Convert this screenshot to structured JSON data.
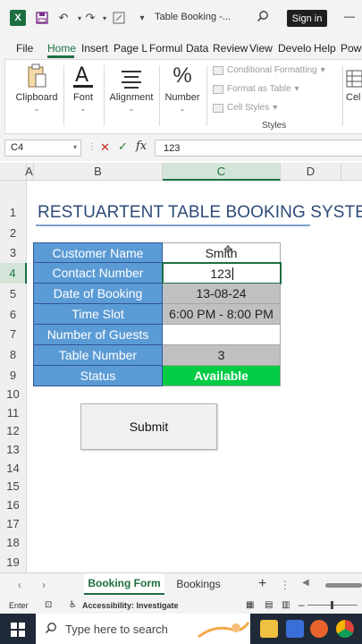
{
  "titlebar": {
    "doc_title": "Table Booking  -...",
    "signin_label": "Sign in",
    "app_logo": "X"
  },
  "menu": {
    "tabs": [
      "File",
      "Home",
      "Insert",
      "Page L",
      "Formul",
      "Data",
      "Review",
      "View",
      "Develo",
      "Help",
      "Powe"
    ],
    "active_tab": "Home"
  },
  "ribbon": {
    "clipboard": "Clipboard",
    "font": "Font",
    "alignment": "Alignment",
    "number": "Number",
    "conditional_formatting": "Conditional Formatting",
    "format_as_table": "Format as Table",
    "cell_styles": "Cell Styles",
    "styles_group": "Styles",
    "cells": "Cel"
  },
  "formula_bar": {
    "name_box": "C4",
    "value": "123"
  },
  "grid": {
    "columns": [
      "A",
      "B",
      "C",
      "D"
    ],
    "selected_column": "C",
    "rows": [
      "1",
      "2",
      "3",
      "4",
      "5",
      "6",
      "7",
      "8",
      "9",
      "10",
      "11",
      "12",
      "13",
      "14",
      "15",
      "16",
      "17",
      "18",
      "19"
    ],
    "selected_row": "4"
  },
  "sheet": {
    "title": "RESTUARTENT TABLE BOOKING SYSTEM",
    "form": [
      {
        "label": "Customer Name",
        "value": "Smith"
      },
      {
        "label": "Contact Number",
        "value": "123"
      },
      {
        "label": "Date of Booking",
        "value": "13-08-24"
      },
      {
        "label": "Time Slot",
        "value": "6:00 PM - 8:00 PM"
      },
      {
        "label": "Number of Guests",
        "value": ""
      },
      {
        "label": "Table Number",
        "value": "3"
      },
      {
        "label": "Status",
        "value": "Available"
      }
    ],
    "submit_label": "Submit"
  },
  "tabs": {
    "sheets": [
      "Booking Form",
      "Bookings"
    ],
    "active": "Booking Form"
  },
  "status": {
    "mode": "Enter",
    "accessibility": "Accessibility: Investigate"
  },
  "taskbar": {
    "search_placeholder": "Type here to search"
  },
  "colors": {
    "excel_green": "#1d6f42",
    "label_blue": "#5b9bd5",
    "status_green": "#00cc44",
    "title_navy": "#2e4b7a"
  }
}
